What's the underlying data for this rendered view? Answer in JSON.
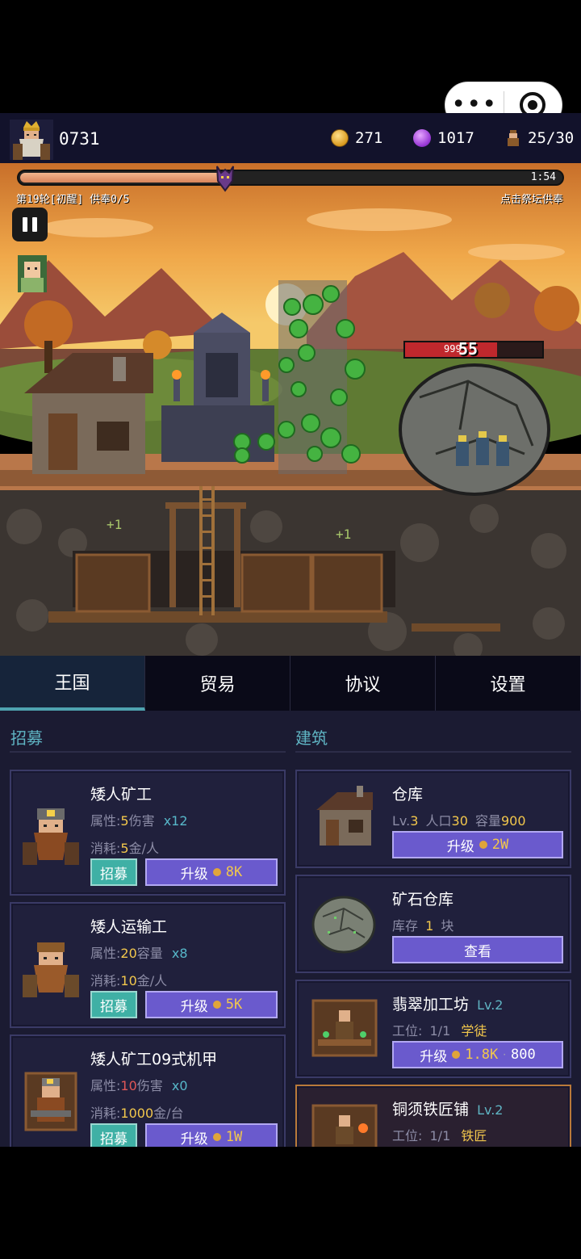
{
  "capsule": {
    "more_icon": "more-dots-icon",
    "close_icon": "target-icon"
  },
  "status": {
    "player_id": "0731",
    "gold": "271",
    "gems": "1017",
    "population": "25/30"
  },
  "scene": {
    "timer": "1:54",
    "progress": 0.38,
    "round_text": "第19轮[初醒] 供奉0/5",
    "tap_hint": "点击祭坛供奉",
    "boss_hp_text": "999",
    "damage_float": "55",
    "plus_one_a": "+1",
    "plus_one_b": "+1"
  },
  "tabs": [
    "王国",
    "贸易",
    "协议",
    "设置"
  ],
  "left": {
    "title": "招募",
    "units": [
      {
        "name": "矮人矿工",
        "attr_pre": "属性:",
        "attr_val": "5",
        "attr_post": "伤害",
        "mult": "x12",
        "cost_pre": "消耗:",
        "cost_val": "5",
        "cost_post": "金/人",
        "recruit": "招募",
        "upgrade": "升级",
        "upgrade_cost": "8K"
      },
      {
        "name": "矮人运输工",
        "attr_pre": "属性:",
        "attr_val": "20",
        "attr_post": "容量",
        "mult": "x8",
        "cost_pre": "消耗:",
        "cost_val": "10",
        "cost_post": "金/人",
        "recruit": "招募",
        "upgrade": "升级",
        "upgrade_cost": "5K"
      },
      {
        "name": "矮人矿工09式机甲",
        "attr_pre": "属性:",
        "attr_val": "10",
        "attr_post": "伤害",
        "mult": "x0",
        "cost_pre": "消耗:",
        "cost_val": "1000",
        "cost_post": "金/台",
        "recruit": "招募",
        "upgrade": "升级",
        "upgrade_cost": "1W"
      }
    ]
  },
  "right": {
    "title": "建筑",
    "buildings": [
      {
        "name": "仓库",
        "lv_pre": "Lv.",
        "lv": "3",
        "pop_pre": "人口",
        "pop": "30",
        "cap_pre": "容量",
        "cap": "900",
        "button": "升级",
        "cost": "2W"
      },
      {
        "name": "矿石仓库",
        "stock_pre": "库存",
        "stock": "1",
        "stock_post": "块",
        "button": "查看"
      },
      {
        "name": "翡翠加工坊",
        "lv": "Lv.2",
        "slot_pre": "工位:",
        "slot": "1/1",
        "worker": "学徒",
        "button": "升级",
        "cost": "1.8K",
        "cost2": "800"
      },
      {
        "name": "铜须铁匠铺",
        "lv": "Lv.2",
        "slot_pre": "工位:",
        "slot": "1/1",
        "worker": "铁匠"
      }
    ]
  }
}
